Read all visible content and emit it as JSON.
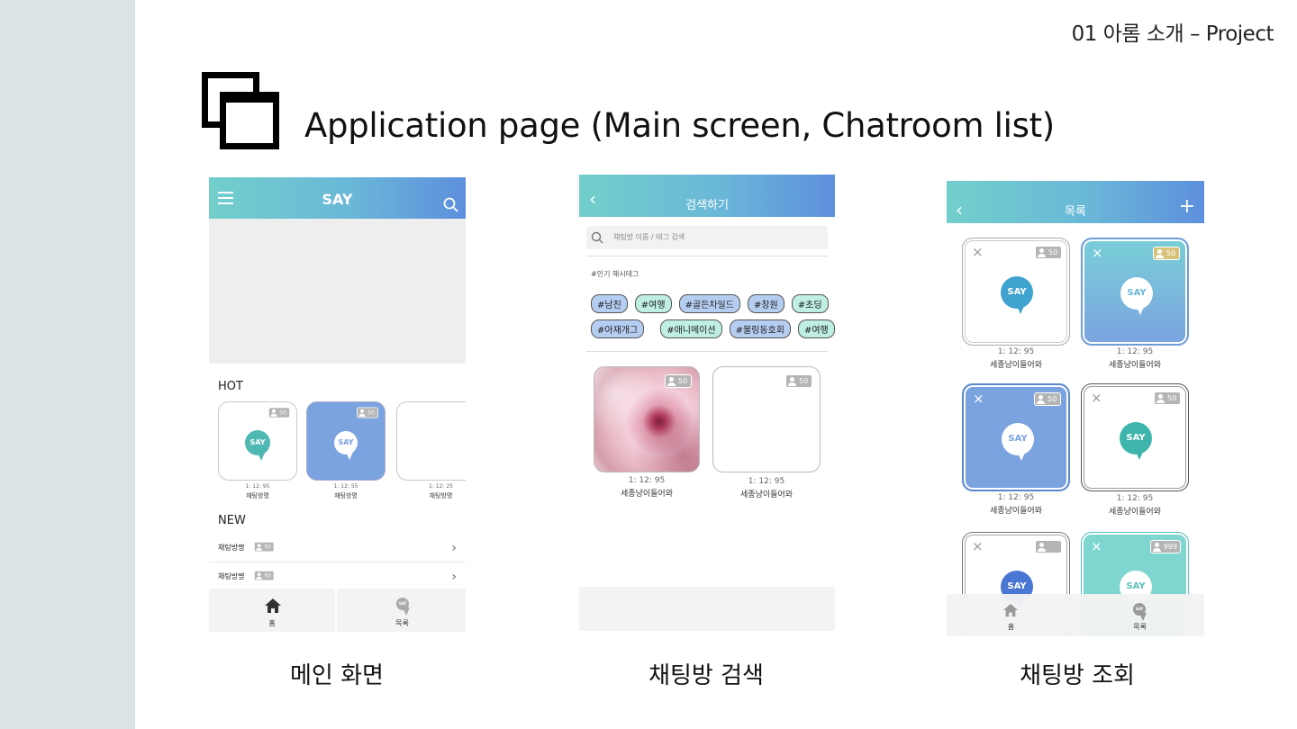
{
  "slide": {
    "label": "01 아롬 소개 – Project",
    "title": "Application page (Main screen, Chatroom list)"
  },
  "captions": [
    "메인 화면",
    "채팅방 검색",
    "채팅방 조회"
  ],
  "colors": {
    "accent_teal": "#72cfcb",
    "accent_blue": "#5d8fdd",
    "card_blue": "#7ba3e0",
    "card_mint": "#7fd6d0"
  },
  "screen_main": {
    "logo": "SAY",
    "hot_label": "HOT",
    "new_label": "NEW",
    "hot_cards": [
      {
        "badge": "50",
        "time": "1: 12: 95",
        "name": "채팅방명"
      },
      {
        "badge": "50",
        "time": "1: 12: 55",
        "name": "채팅방명"
      },
      {
        "badge": "",
        "time": "1: 12: 25",
        "name": "채팅방명"
      }
    ],
    "new_rows": [
      {
        "name": "채팅방명",
        "badge": "50"
      },
      {
        "name": "채팅방명",
        "badge": "50"
      }
    ],
    "tabs": {
      "home": "홈",
      "list": "목록"
    }
  },
  "screen_search": {
    "header": "검색하기",
    "placeholder": "채팅방 이름 / 태그 검색",
    "popular_label": "#인기 해시태그",
    "tags_row1": [
      "#남친",
      "#여행",
      "#골든차일드",
      "#창원",
      "#초딩"
    ],
    "tags_row2": [
      "#아재개그",
      "#애니메이션",
      "#불링동호회",
      "#여행"
    ],
    "cards": [
      {
        "badge": "50",
        "time": "1: 12: 95",
        "name": "세종냥이들어와"
      },
      {
        "badge": "50",
        "time": "1: 12: 95",
        "name": "세종냥이들어와"
      }
    ]
  },
  "screen_list": {
    "header": "목록",
    "logo": "SAY",
    "cards": [
      {
        "badge": "50",
        "time": "1: 12: 95",
        "name": "세종냥이들어와"
      },
      {
        "badge": "50",
        "time": "1: 12: 95",
        "name": "세종냥이들어와"
      },
      {
        "badge": "50",
        "time": "1: 12: 95",
        "name": "세종냥이들어와"
      },
      {
        "badge": "50",
        "time": "1: 12: 95",
        "name": "세종냥이들어와"
      },
      {
        "badge": "",
        "time": "",
        "name": ""
      },
      {
        "badge": "999",
        "time": "",
        "name": ""
      }
    ],
    "tabs": {
      "home": "홈",
      "list": "목록"
    }
  }
}
